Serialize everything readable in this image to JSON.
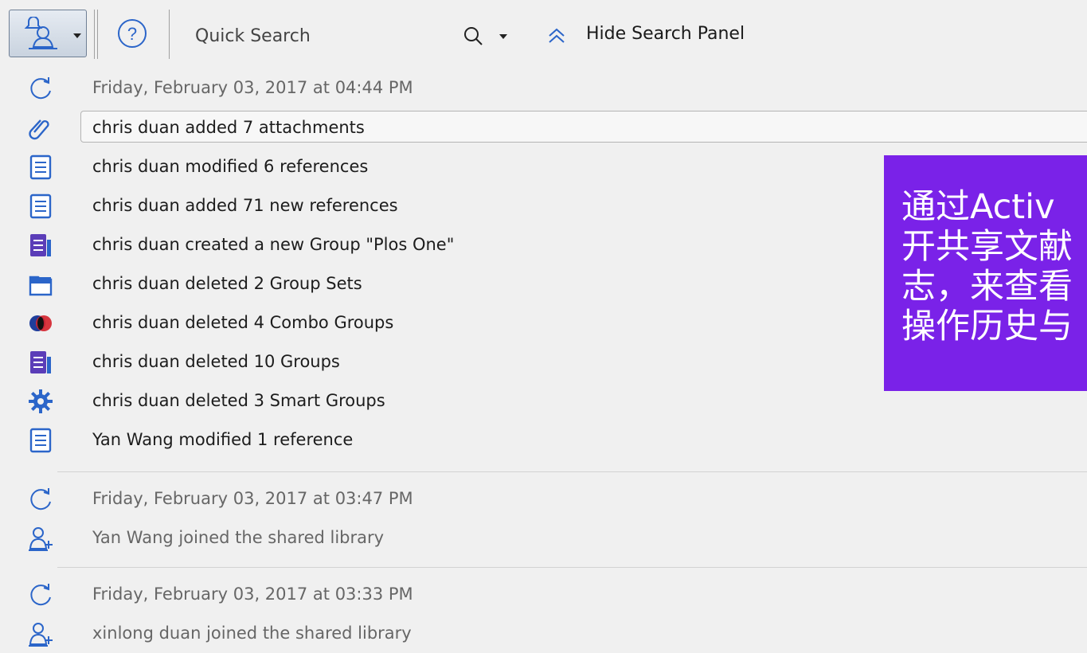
{
  "toolbar": {
    "user_menu_icon": "user-bell-icon",
    "help_icon": "help-circle-icon",
    "search": {
      "placeholder": "Quick Search"
    },
    "hide_panel_label": "Hide Search Panel"
  },
  "feed": {
    "groups": [
      {
        "date": "Friday, February 03, 2017 at 04:44 PM",
        "events": [
          {
            "icon": "attachment-icon",
            "text": "chris duan added 7 attachments",
            "selected": true
          },
          {
            "icon": "reference-icon",
            "text": "chris duan modified 6 references"
          },
          {
            "icon": "reference-icon",
            "text": "chris duan added 71 new references"
          },
          {
            "icon": "group-icon",
            "text": "chris duan created a new Group \"Plos One\""
          },
          {
            "icon": "folder-icon",
            "text": "chris duan deleted 2 Group Sets"
          },
          {
            "icon": "combo-group-icon",
            "text": "chris duan deleted 4 Combo Groups"
          },
          {
            "icon": "group-icon",
            "text": "chris duan deleted 10 Groups"
          },
          {
            "icon": "smart-group-gear-icon",
            "text": "chris duan deleted 3 Smart Groups"
          },
          {
            "icon": "reference-icon",
            "text": "Yan Wang modified 1 reference"
          }
        ]
      },
      {
        "date": "Friday, February 03, 2017 at 03:47 PM",
        "events": [
          {
            "icon": "add-user-icon",
            "text": "Yan Wang joined the shared library"
          }
        ]
      },
      {
        "date": "Friday, February 03, 2017 at 03:33 PM",
        "events": [
          {
            "icon": "add-user-icon",
            "text": "xinlong duan joined the shared library"
          }
        ]
      }
    ]
  },
  "overlay": {
    "lines": [
      "通过Activ",
      "开共享文献",
      "志，来查看",
      "操作历史与"
    ]
  },
  "colors": {
    "overlay": "#7a22e8",
    "accent": "#2b65c9"
  }
}
